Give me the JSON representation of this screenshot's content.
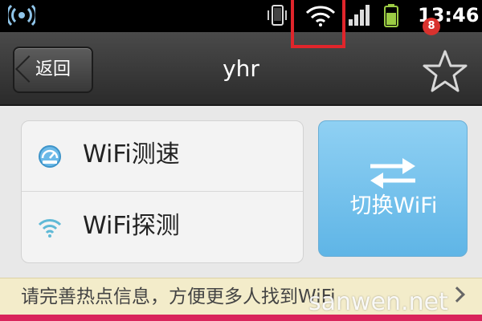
{
  "status_bar": {
    "time": "13:46",
    "icons": [
      "wifi-hotspot-icon",
      "phone-vibrate-icon",
      "wifi-signal-icon",
      "cell-signal-icon",
      "battery-icon"
    ]
  },
  "header": {
    "back_label": "返回",
    "title": "yhr",
    "favorite_badge": "8",
    "favorite_icon": "star-icon"
  },
  "menu": {
    "items": [
      {
        "label": "WiFi测速",
        "icon": "speedometer-icon"
      },
      {
        "label": "WiFi探测",
        "icon": "wifi-icon"
      }
    ],
    "switch_label": "切换WiFi",
    "switch_icon": "swap-arrows-icon"
  },
  "notice": {
    "text": "请完善热点信息，方便更多人找到WiFi"
  },
  "watermark": "sanwen.net",
  "colors": {
    "accent_blue": "#5fb5e6",
    "highlight_red": "#e0252b",
    "badge_red": "#d8322e",
    "notice_bg": "#f3ecca",
    "bottom_strip": "#d9245b"
  }
}
